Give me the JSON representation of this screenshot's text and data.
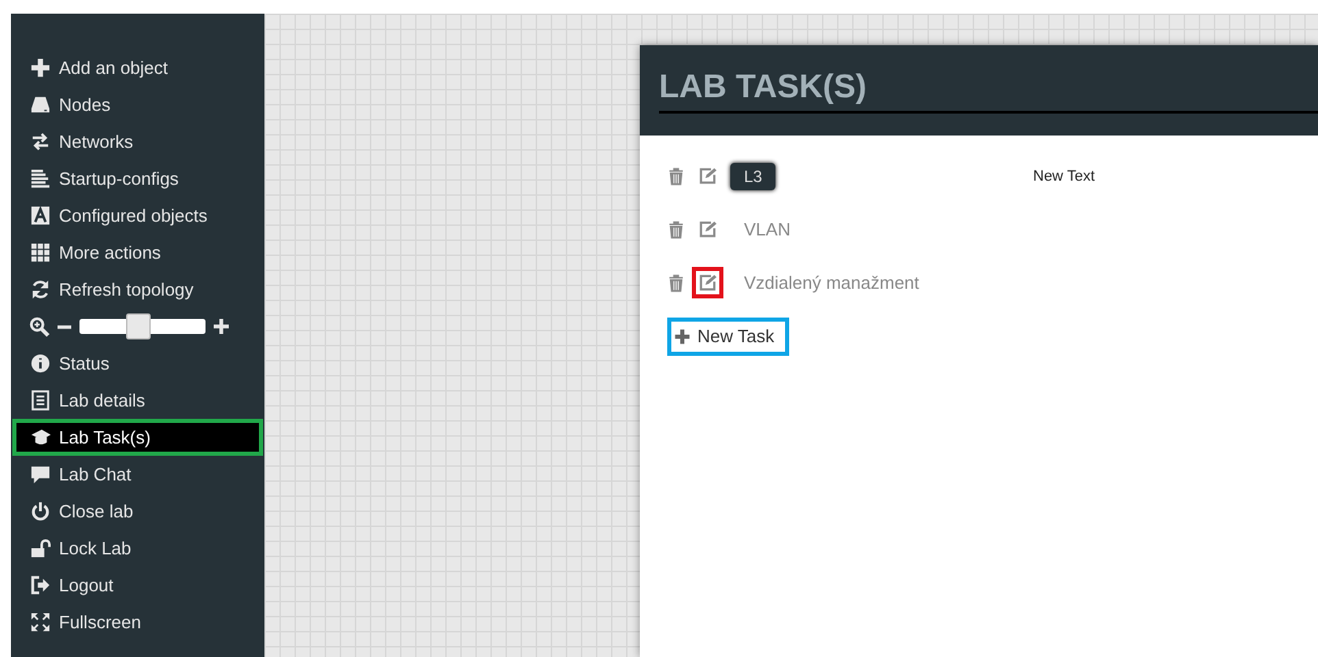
{
  "sidebar": {
    "items": [
      {
        "kind": "link",
        "label": "Add an object",
        "selected": false
      },
      {
        "kind": "link",
        "label": "Nodes",
        "selected": false
      },
      {
        "kind": "link",
        "label": "Networks",
        "selected": false
      },
      {
        "kind": "link",
        "label": "Startup-configs",
        "selected": false
      },
      {
        "kind": "link",
        "label": "Configured objects",
        "selected": false
      },
      {
        "kind": "link",
        "label": "More actions",
        "selected": false
      },
      {
        "kind": "link",
        "label": "Refresh topology",
        "selected": false
      },
      {
        "kind": "zoom",
        "level": 0.47
      },
      {
        "kind": "link",
        "label": "Status",
        "selected": false
      },
      {
        "kind": "link",
        "label": "Lab details",
        "selected": false
      },
      {
        "kind": "link",
        "label": "Lab Task(s)",
        "selected": true
      },
      {
        "kind": "link",
        "label": "Lab Chat",
        "selected": false
      },
      {
        "kind": "link",
        "label": "Close lab",
        "selected": false
      },
      {
        "kind": "link",
        "label": "Lock Lab",
        "selected": false
      },
      {
        "kind": "link",
        "label": "Logout",
        "selected": false
      },
      {
        "kind": "link",
        "label": "Fullscreen",
        "selected": false
      }
    ]
  },
  "modal": {
    "title": "LAB TASK(S)",
    "tasks": [
      {
        "label": "L3",
        "selected": true,
        "edit_highlighted": false
      },
      {
        "label": "VLAN",
        "selected": false,
        "edit_highlighted": false
      },
      {
        "label": "Vzdialený manažment",
        "selected": false,
        "edit_highlighted": true
      }
    ],
    "detail_text": "New Text",
    "new_task_button": {
      "label": "New Task",
      "highlighted": true
    }
  }
}
